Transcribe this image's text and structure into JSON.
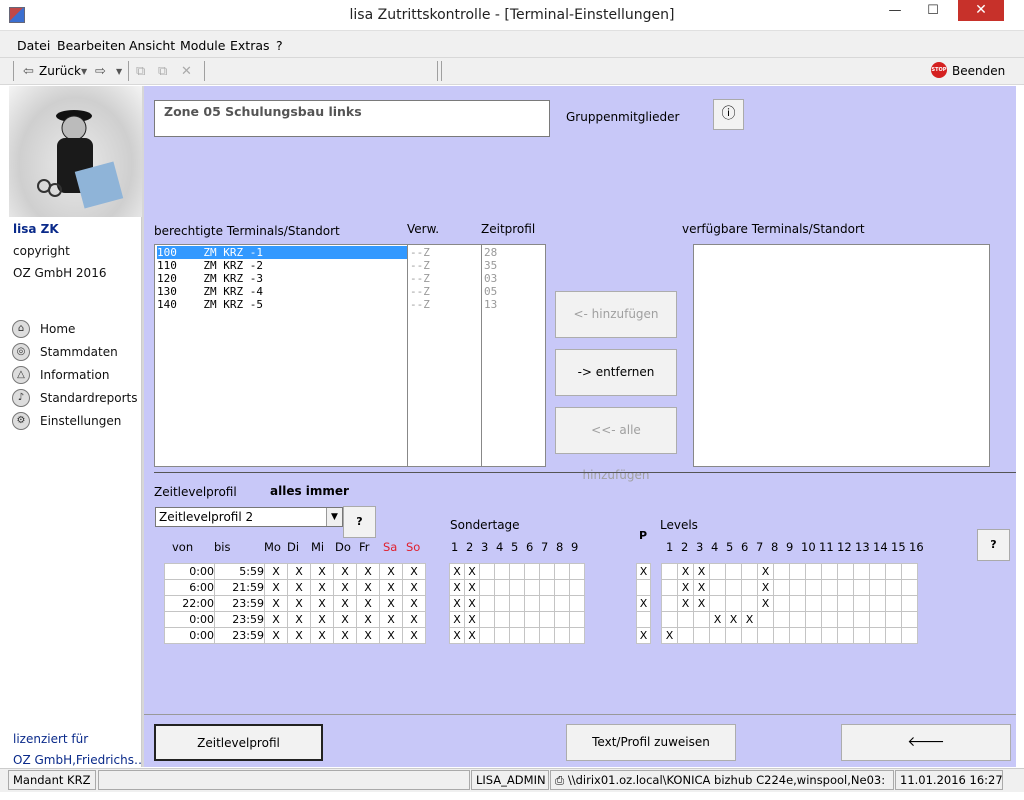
{
  "window": {
    "title": "lisa Zutrittskontrolle - [Terminal-Einstellungen]",
    "minimize": "—",
    "maximize": "☐",
    "close": "✕"
  },
  "menu": [
    "Datei",
    "Bearbeiten",
    "Ansicht",
    "Module",
    "Extras",
    "?"
  ],
  "toolbar": {
    "back_label": "Zurück",
    "exit_label": "Beenden",
    "exit_icon_text": "STOP"
  },
  "sidebar": {
    "product": "lisa ZK",
    "copyright": "copyright",
    "company": "OZ GmbH 2016",
    "nav": [
      {
        "label": "Home",
        "icon": "home-icon"
      },
      {
        "label": "Stammdaten",
        "icon": "master-data-icon"
      },
      {
        "label": "Information",
        "icon": "information-icon"
      },
      {
        "label": "Standardreports",
        "icon": "reports-icon"
      },
      {
        "label": "Einstellungen",
        "icon": "settings-icon"
      }
    ],
    "licensed_for": "lizenziert für",
    "licensee": "OZ GmbH,Friedrichs…"
  },
  "zone": {
    "name": "Zone 05 Schulungsbau links",
    "group_members_label": "Gruppenmitglieder"
  },
  "terminals": {
    "authorized_header": "berechtigte Terminals/Standort",
    "verw_header": "Verw.",
    "zeitprofil_header": "Zeitprofil",
    "available_header": "verfügbare Terminals/Standort",
    "rows": [
      {
        "id": "100",
        "name": "ZM KRZ -1",
        "verw": "--Z",
        "profil": "28"
      },
      {
        "id": "110",
        "name": "ZM KRZ -2",
        "verw": "--Z",
        "profil": "35"
      },
      {
        "id": "120",
        "name": "ZM KRZ -3",
        "verw": "--Z",
        "profil": "03"
      },
      {
        "id": "130",
        "name": "ZM KRZ -4",
        "verw": "--Z",
        "profil": "05"
      },
      {
        "id": "140",
        "name": "ZM KRZ -5",
        "verw": "--Z",
        "profil": "13"
      }
    ],
    "add_label": "<- hinzufügen",
    "remove_label": "-> entfernen",
    "add_all_label": "<<- alle hinzufügen"
  },
  "timeprofile": {
    "label": "Zeitlevelprofil",
    "value_text": "alles immer",
    "selected": "Zeitlevelprofil 2",
    "help": "?",
    "headers": {
      "von": "von",
      "bis": "bis",
      "days": [
        "Mo",
        "Di",
        "Mi",
        "Do",
        "Fr",
        "Sa",
        "So"
      ]
    },
    "rows": [
      {
        "von": "0:00",
        "bis": "5:59",
        "days": [
          "X",
          "X",
          "X",
          "X",
          "X",
          "X",
          "X"
        ]
      },
      {
        "von": "6:00",
        "bis": "21:59",
        "days": [
          "X",
          "X",
          "X",
          "X",
          "X",
          "X",
          "X"
        ]
      },
      {
        "von": "22:00",
        "bis": "23:59",
        "days": [
          "X",
          "X",
          "X",
          "X",
          "X",
          "X",
          "X"
        ]
      },
      {
        "von": "0:00",
        "bis": "23:59",
        "days": [
          "X",
          "X",
          "X",
          "X",
          "X",
          "X",
          "X"
        ]
      },
      {
        "von": "0:00",
        "bis": "23:59",
        "days": [
          "X",
          "X",
          "X",
          "X",
          "X",
          "X",
          "X"
        ]
      }
    ],
    "sondertage_label": "Sondertage",
    "sondertage_cols": [
      "1",
      "2",
      "3",
      "4",
      "5",
      "6",
      "7",
      "8",
      "9"
    ],
    "sondertage": [
      [
        "X",
        "X",
        "",
        "",
        "",
        "",
        "",
        "",
        ""
      ],
      [
        "X",
        "X",
        "",
        "",
        "",
        "",
        "",
        "",
        ""
      ],
      [
        "X",
        "X",
        "",
        "",
        "",
        "",
        "",
        "",
        ""
      ],
      [
        "X",
        "X",
        "",
        "",
        "",
        "",
        "",
        "",
        ""
      ],
      [
        "X",
        "X",
        "",
        "",
        "",
        "",
        "",
        "",
        ""
      ]
    ],
    "p_label": "P",
    "p": [
      "X",
      "",
      "X",
      "",
      "X"
    ],
    "levels_label": "Levels",
    "levels_cols": [
      "1",
      "2",
      "3",
      "4",
      "5",
      "6",
      "7",
      "8",
      "9",
      "10",
      "11",
      "12",
      "13",
      "14",
      "15",
      "16"
    ],
    "levels": [
      [
        "",
        "X",
        "X",
        "",
        "",
        "",
        "X",
        "",
        "",
        "",
        "",
        "",
        "",
        "",
        "",
        ""
      ],
      [
        "",
        "X",
        "X",
        "",
        "",
        "",
        "X",
        "",
        "",
        "",
        "",
        "",
        "",
        "",
        "",
        ""
      ],
      [
        "",
        "X",
        "X",
        "",
        "",
        "",
        "X",
        "",
        "",
        "",
        "",
        "",
        "",
        "",
        "",
        ""
      ],
      [
        "",
        "",
        "",
        "X",
        "X",
        "X",
        "",
        "",
        "",
        "",
        "",
        "",
        "",
        "",
        "",
        ""
      ],
      [
        "X",
        "",
        "",
        "",
        "",
        "",
        "",
        "",
        "",
        "",
        "",
        "",
        "",
        "",
        "",
        ""
      ]
    ],
    "levels_help": "?"
  },
  "bottom": {
    "zeitlevelprofil_btn": "Zeitlevelprofil",
    "text_profil_btn": "Text/Profil zuweisen",
    "back_arrow": "🡐"
  },
  "status": {
    "mandant": "Mandant KRZ",
    "user": "LISA_ADMIN",
    "printer": "\\\\dirix01.oz.local\\KONICA bizhub C224e,winspool,Ne03:",
    "datetime": "11.01.2016 16:27"
  }
}
